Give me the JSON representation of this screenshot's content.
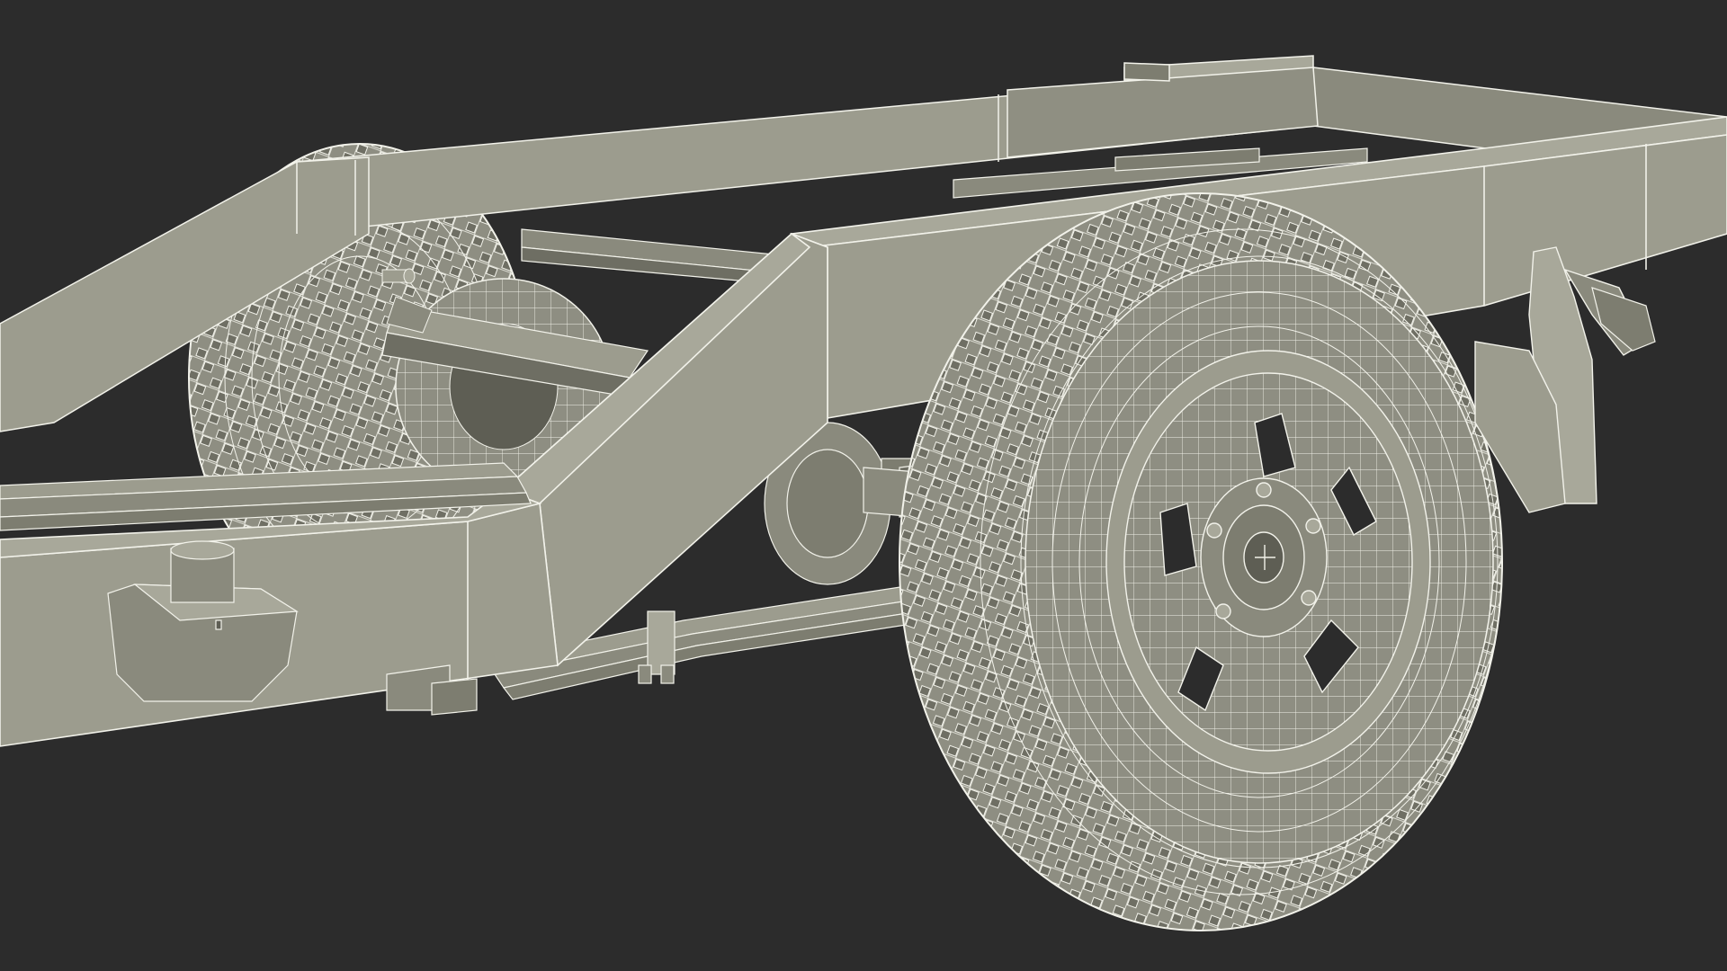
{
  "scene": {
    "background_color": "#2c2c2c",
    "body_color": "#9c9c8e",
    "body_shade_color": "#7d7d70",
    "body_dark_color": "#5e5e54",
    "wire_color": "#f2f2ea",
    "tire_color": "#8e8e82",
    "tire_dark_color": "#5a5a50"
  }
}
